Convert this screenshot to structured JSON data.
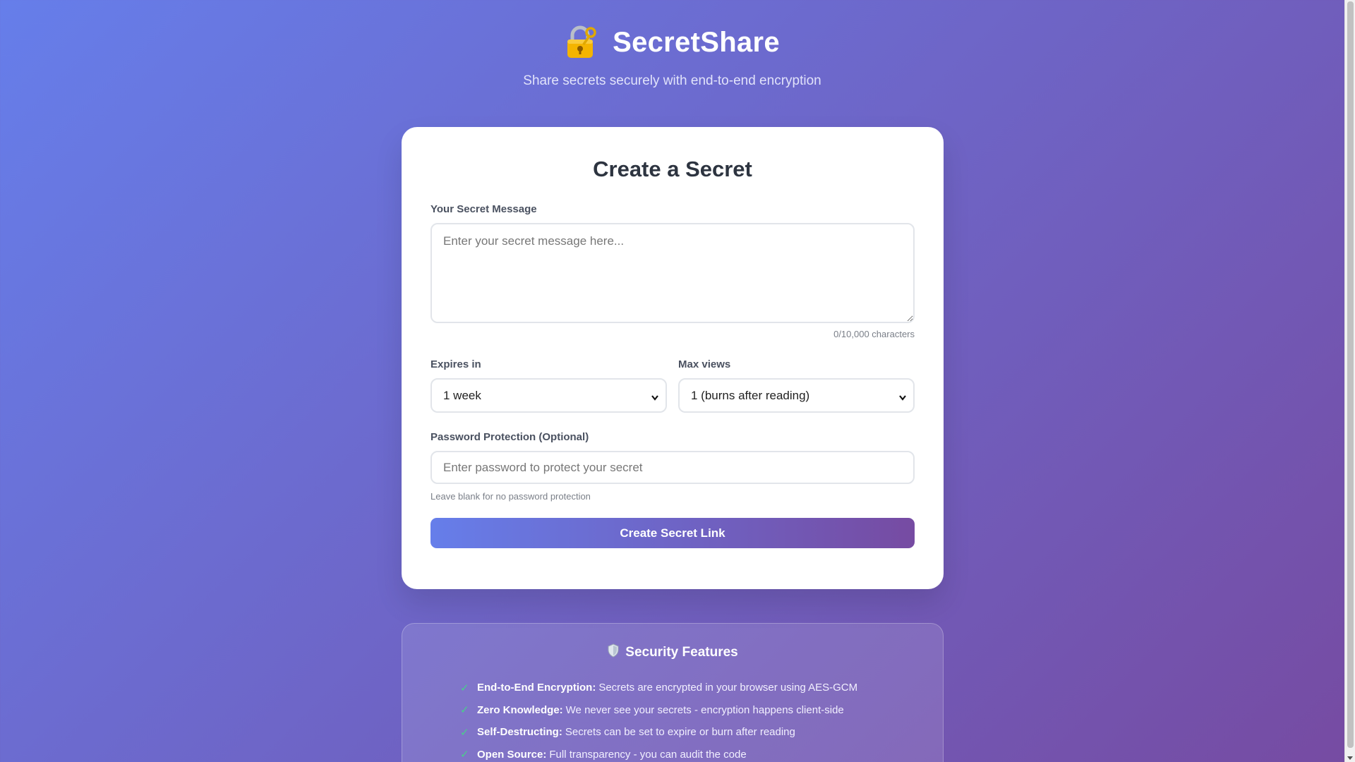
{
  "header": {
    "icon": "locked-with-key-icon",
    "title": "SecretShare",
    "subtitle": "Share secrets securely with end-to-end encryption"
  },
  "form": {
    "title": "Create a Secret",
    "message_label": "Your Secret Message",
    "message_placeholder": "Enter your secret message here...",
    "message_value": "",
    "char_count": "0/10,000 characters",
    "expires_label": "Expires in",
    "expires_value": "1 week",
    "max_views_label": "Max views",
    "max_views_value": "1 (burns after reading)",
    "password_label": "Password Protection (Optional)",
    "password_placeholder": "Enter password to protect your secret",
    "password_hint": "Leave blank for no password protection",
    "submit_label": "Create Secret Link"
  },
  "features": {
    "icon": "shield-icon",
    "title": "Security Features",
    "items": [
      {
        "name": "End-to-End Encryption:",
        "desc": "Secrets are encrypted in your browser using AES-GCM"
      },
      {
        "name": "Zero Knowledge:",
        "desc": "We never see your secrets - encryption happens client-side"
      },
      {
        "name": "Self-Destructing:",
        "desc": "Secrets can be set to expire or burn after reading"
      },
      {
        "name": "Open Source:",
        "desc": "Full transparency - you can audit the code"
      }
    ]
  },
  "colors": {
    "gradient_start": "#667eea",
    "gradient_end": "#764ba2",
    "check": "#48d08a"
  }
}
